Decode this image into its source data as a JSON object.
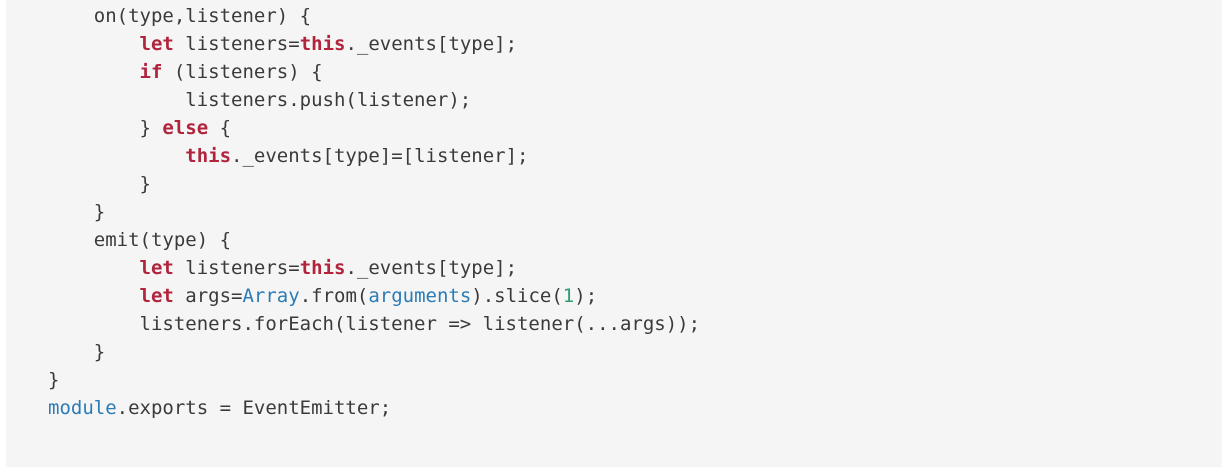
{
  "colors": {
    "panel_bg": "#f5f5f5",
    "default_text": "#3a3a3a",
    "keyword": "#b0243c",
    "builtin": "#2b7bb5",
    "number": "#2f9c6f"
  },
  "code": {
    "lines": [
      [
        {
          "t": "    on(type,listener) {",
          "c": "plain"
        }
      ],
      [
        {
          "t": "        ",
          "c": "plain"
        },
        {
          "t": "let",
          "c": "kw"
        },
        {
          "t": " listeners=",
          "c": "plain"
        },
        {
          "t": "this",
          "c": "kw"
        },
        {
          "t": "._events[type];",
          "c": "plain"
        }
      ],
      [
        {
          "t": "        ",
          "c": "plain"
        },
        {
          "t": "if",
          "c": "kw"
        },
        {
          "t": " (listeners) {",
          "c": "plain"
        }
      ],
      [
        {
          "t": "            listeners.push(listener);",
          "c": "plain"
        }
      ],
      [
        {
          "t": "        } ",
          "c": "plain"
        },
        {
          "t": "else",
          "c": "kw"
        },
        {
          "t": " {",
          "c": "plain"
        }
      ],
      [
        {
          "t": "            ",
          "c": "plain"
        },
        {
          "t": "this",
          "c": "kw"
        },
        {
          "t": "._events[type]=[listener];",
          "c": "plain"
        }
      ],
      [
        {
          "t": "        }",
          "c": "plain"
        }
      ],
      [
        {
          "t": "    }",
          "c": "plain"
        }
      ],
      [
        {
          "t": "    emit(type) {",
          "c": "plain"
        }
      ],
      [
        {
          "t": "        ",
          "c": "plain"
        },
        {
          "t": "let",
          "c": "kw"
        },
        {
          "t": " listeners=",
          "c": "plain"
        },
        {
          "t": "this",
          "c": "kw"
        },
        {
          "t": "._events[type];",
          "c": "plain"
        }
      ],
      [
        {
          "t": "        ",
          "c": "plain"
        },
        {
          "t": "let",
          "c": "kw"
        },
        {
          "t": " args=",
          "c": "plain"
        },
        {
          "t": "Array",
          "c": "blue"
        },
        {
          "t": ".from(",
          "c": "plain"
        },
        {
          "t": "arguments",
          "c": "blue"
        },
        {
          "t": ").slice(",
          "c": "plain"
        },
        {
          "t": "1",
          "c": "num"
        },
        {
          "t": ");",
          "c": "plain"
        }
      ],
      [
        {
          "t": "        listeners.forEach(listener => listener(...args));",
          "c": "plain"
        }
      ],
      [
        {
          "t": "    }",
          "c": "plain"
        }
      ],
      [
        {
          "t": "}",
          "c": "plain"
        }
      ],
      [
        {
          "t": "module",
          "c": "blue"
        },
        {
          "t": ".exports = EventEmitter;",
          "c": "plain"
        }
      ]
    ]
  }
}
